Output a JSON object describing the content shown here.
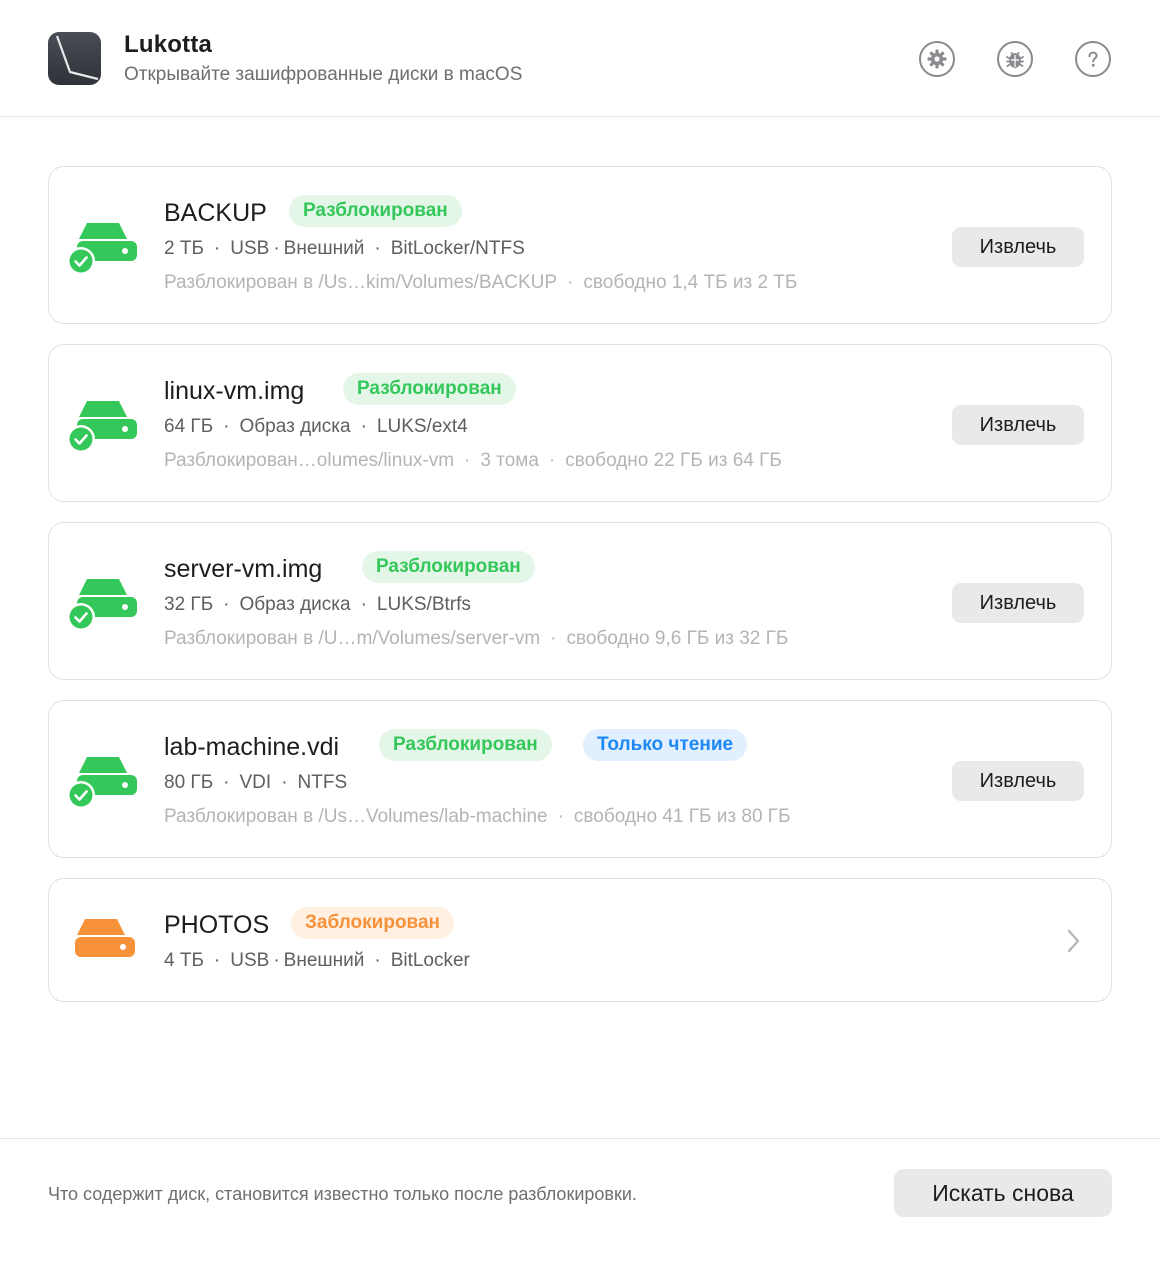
{
  "header": {
    "app_name": "Lukotta",
    "subtitle": "Открывайте зашифрованные диски в macOS",
    "icons": [
      "gear-icon",
      "bug-icon",
      "help-icon"
    ]
  },
  "colors": {
    "unlocked_green": "#34c759",
    "locked_orange": "#f7923a",
    "readonly_blue": "#1e88f5"
  },
  "disks": [
    {
      "name": "BACKUP",
      "status": "Разблокирован",
      "size": "2 ТБ",
      "bus": "USB",
      "location": "Внешний",
      "format": "BitLocker/NTFS",
      "mount": "Разблокирован в /Us…kim/Volumes/BACKUP",
      "free": "свободно 1,4 ТБ из 2 ТБ",
      "action": "Извлечь"
    },
    {
      "name": "linux-vm.img",
      "status": "Разблокирован",
      "size": "64 ГБ",
      "kind": "Образ диска",
      "format": "LUKS/ext4",
      "mount": "Разблокирован…olumes/linux-vm",
      "volumes": "3 тома",
      "free": "свободно 22 ГБ из 64 ГБ",
      "action": "Извлечь"
    },
    {
      "name": "server-vm.img",
      "status": "Разблокирован",
      "size": "32 ГБ",
      "kind": "Образ диска",
      "format": "LUKS/Btrfs",
      "mount": "Разблокирован в /U…m/Volumes/server-vm",
      "free": "свободно 9,6 ГБ из 32 ГБ",
      "action": "Извлечь"
    },
    {
      "name": "lab-machine.vdi",
      "status": "Разблокирован",
      "extra_badge": "Только чтение",
      "size": "80 ГБ",
      "kind": "VDI",
      "format": "NTFS",
      "mount": "Разблокирован в /Us…Volumes/lab-machine",
      "free": "свободно 41 ГБ из 80 ГБ",
      "action": "Извлечь"
    },
    {
      "name": "PHOTOS",
      "status": "Заблокирован",
      "size": "4 ТБ",
      "bus": "USB",
      "location": "Внешний",
      "format": "BitLocker"
    }
  ],
  "footer": {
    "note": "Что содержит диск, становится известно только после разблокировки.",
    "rescan_label": "Искать снова"
  }
}
